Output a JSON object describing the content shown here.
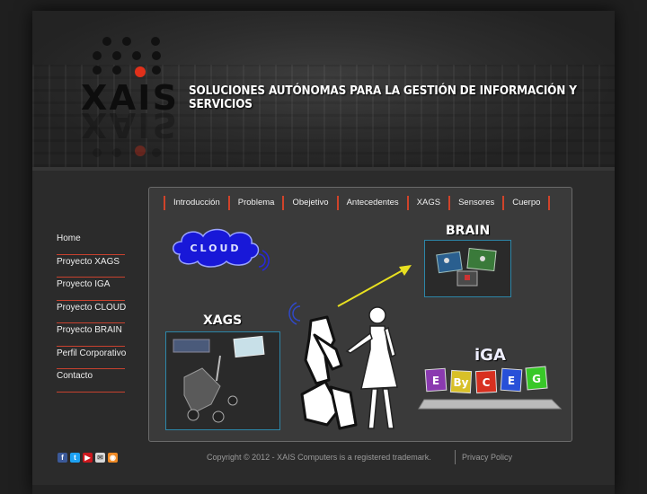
{
  "header": {
    "logo_text": "XAIS",
    "tagline": "SOLUCIONES AUTÓNOMAS PARA LA GESTIÓN DE INFORMACIÓN Y SERVICIOS"
  },
  "sidebar": {
    "items": [
      {
        "label": "Home"
      },
      {
        "label": "Proyecto XAGS"
      },
      {
        "label": "Proyecto IGA"
      },
      {
        "label": "Proyecto CLOUD"
      },
      {
        "label": "Proyecto BRAIN"
      },
      {
        "label": "Perfil Corporativo"
      },
      {
        "label": "Contacto"
      }
    ]
  },
  "tabs": [
    {
      "label": "Introducción"
    },
    {
      "label": "Problema"
    },
    {
      "label": "Obejetivo"
    },
    {
      "label": "Antecedentes"
    },
    {
      "label": "XAGS"
    },
    {
      "label": "Sensores"
    },
    {
      "label": "Cuerpo"
    }
  ],
  "diagram": {
    "cloud_label": "CLOUD",
    "brain_label": "BRAIN",
    "xags_label": "XAGS",
    "iga_label": "iGA",
    "iga_blocks": [
      "E",
      "By",
      "C",
      "E",
      "G"
    ]
  },
  "footer": {
    "copyright": "Copyright © 2012 - XAIS Computers is a registered trademark.",
    "privacy": "Privacy Policy",
    "social_icons": [
      "facebook-icon",
      "twitter-icon",
      "youtube-icon",
      "email-icon",
      "rss-icon"
    ]
  },
  "colors": {
    "accent_red": "#d0432a",
    "photo_border": "#2d86a8",
    "cloud_blue": "#1a1ae0",
    "arrow_yellow": "#e8e020"
  }
}
